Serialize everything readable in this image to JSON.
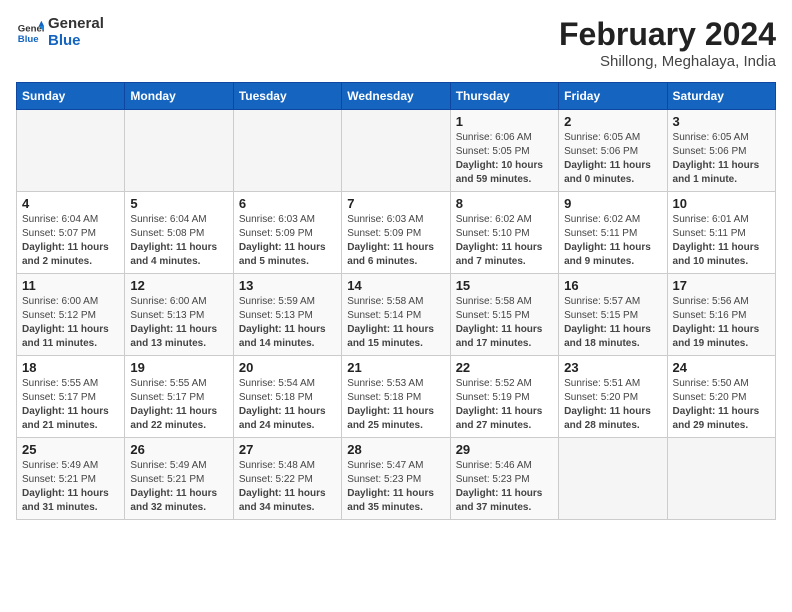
{
  "header": {
    "logo_line1": "General",
    "logo_line2": "Blue",
    "title": "February 2024",
    "subtitle": "Shillong, Meghalaya, India"
  },
  "days_of_week": [
    "Sunday",
    "Monday",
    "Tuesday",
    "Wednesday",
    "Thursday",
    "Friday",
    "Saturday"
  ],
  "weeks": [
    [
      {
        "day": "",
        "sunrise": "",
        "sunset": "",
        "daylight": "",
        "empty": true
      },
      {
        "day": "",
        "sunrise": "",
        "sunset": "",
        "daylight": "",
        "empty": true
      },
      {
        "day": "",
        "sunrise": "",
        "sunset": "",
        "daylight": "",
        "empty": true
      },
      {
        "day": "",
        "sunrise": "",
        "sunset": "",
        "daylight": "",
        "empty": true
      },
      {
        "day": "1",
        "sunrise": "Sunrise: 6:06 AM",
        "sunset": "Sunset: 5:05 PM",
        "daylight": "Daylight: 10 hours and 59 minutes.",
        "empty": false
      },
      {
        "day": "2",
        "sunrise": "Sunrise: 6:05 AM",
        "sunset": "Sunset: 5:06 PM",
        "daylight": "Daylight: 11 hours and 0 minutes.",
        "empty": false
      },
      {
        "day": "3",
        "sunrise": "Sunrise: 6:05 AM",
        "sunset": "Sunset: 5:06 PM",
        "daylight": "Daylight: 11 hours and 1 minute.",
        "empty": false
      }
    ],
    [
      {
        "day": "4",
        "sunrise": "Sunrise: 6:04 AM",
        "sunset": "Sunset: 5:07 PM",
        "daylight": "Daylight: 11 hours and 2 minutes.",
        "empty": false
      },
      {
        "day": "5",
        "sunrise": "Sunrise: 6:04 AM",
        "sunset": "Sunset: 5:08 PM",
        "daylight": "Daylight: 11 hours and 4 minutes.",
        "empty": false
      },
      {
        "day": "6",
        "sunrise": "Sunrise: 6:03 AM",
        "sunset": "Sunset: 5:09 PM",
        "daylight": "Daylight: 11 hours and 5 minutes.",
        "empty": false
      },
      {
        "day": "7",
        "sunrise": "Sunrise: 6:03 AM",
        "sunset": "Sunset: 5:09 PM",
        "daylight": "Daylight: 11 hours and 6 minutes.",
        "empty": false
      },
      {
        "day": "8",
        "sunrise": "Sunrise: 6:02 AM",
        "sunset": "Sunset: 5:10 PM",
        "daylight": "Daylight: 11 hours and 7 minutes.",
        "empty": false
      },
      {
        "day": "9",
        "sunrise": "Sunrise: 6:02 AM",
        "sunset": "Sunset: 5:11 PM",
        "daylight": "Daylight: 11 hours and 9 minutes.",
        "empty": false
      },
      {
        "day": "10",
        "sunrise": "Sunrise: 6:01 AM",
        "sunset": "Sunset: 5:11 PM",
        "daylight": "Daylight: 11 hours and 10 minutes.",
        "empty": false
      }
    ],
    [
      {
        "day": "11",
        "sunrise": "Sunrise: 6:00 AM",
        "sunset": "Sunset: 5:12 PM",
        "daylight": "Daylight: 11 hours and 11 minutes.",
        "empty": false
      },
      {
        "day": "12",
        "sunrise": "Sunrise: 6:00 AM",
        "sunset": "Sunset: 5:13 PM",
        "daylight": "Daylight: 11 hours and 13 minutes.",
        "empty": false
      },
      {
        "day": "13",
        "sunrise": "Sunrise: 5:59 AM",
        "sunset": "Sunset: 5:13 PM",
        "daylight": "Daylight: 11 hours and 14 minutes.",
        "empty": false
      },
      {
        "day": "14",
        "sunrise": "Sunrise: 5:58 AM",
        "sunset": "Sunset: 5:14 PM",
        "daylight": "Daylight: 11 hours and 15 minutes.",
        "empty": false
      },
      {
        "day": "15",
        "sunrise": "Sunrise: 5:58 AM",
        "sunset": "Sunset: 5:15 PM",
        "daylight": "Daylight: 11 hours and 17 minutes.",
        "empty": false
      },
      {
        "day": "16",
        "sunrise": "Sunrise: 5:57 AM",
        "sunset": "Sunset: 5:15 PM",
        "daylight": "Daylight: 11 hours and 18 minutes.",
        "empty": false
      },
      {
        "day": "17",
        "sunrise": "Sunrise: 5:56 AM",
        "sunset": "Sunset: 5:16 PM",
        "daylight": "Daylight: 11 hours and 19 minutes.",
        "empty": false
      }
    ],
    [
      {
        "day": "18",
        "sunrise": "Sunrise: 5:55 AM",
        "sunset": "Sunset: 5:17 PM",
        "daylight": "Daylight: 11 hours and 21 minutes.",
        "empty": false
      },
      {
        "day": "19",
        "sunrise": "Sunrise: 5:55 AM",
        "sunset": "Sunset: 5:17 PM",
        "daylight": "Daylight: 11 hours and 22 minutes.",
        "empty": false
      },
      {
        "day": "20",
        "sunrise": "Sunrise: 5:54 AM",
        "sunset": "Sunset: 5:18 PM",
        "daylight": "Daylight: 11 hours and 24 minutes.",
        "empty": false
      },
      {
        "day": "21",
        "sunrise": "Sunrise: 5:53 AM",
        "sunset": "Sunset: 5:18 PM",
        "daylight": "Daylight: 11 hours and 25 minutes.",
        "empty": false
      },
      {
        "day": "22",
        "sunrise": "Sunrise: 5:52 AM",
        "sunset": "Sunset: 5:19 PM",
        "daylight": "Daylight: 11 hours and 27 minutes.",
        "empty": false
      },
      {
        "day": "23",
        "sunrise": "Sunrise: 5:51 AM",
        "sunset": "Sunset: 5:20 PM",
        "daylight": "Daylight: 11 hours and 28 minutes.",
        "empty": false
      },
      {
        "day": "24",
        "sunrise": "Sunrise: 5:50 AM",
        "sunset": "Sunset: 5:20 PM",
        "daylight": "Daylight: 11 hours and 29 minutes.",
        "empty": false
      }
    ],
    [
      {
        "day": "25",
        "sunrise": "Sunrise: 5:49 AM",
        "sunset": "Sunset: 5:21 PM",
        "daylight": "Daylight: 11 hours and 31 minutes.",
        "empty": false
      },
      {
        "day": "26",
        "sunrise": "Sunrise: 5:49 AM",
        "sunset": "Sunset: 5:21 PM",
        "daylight": "Daylight: 11 hours and 32 minutes.",
        "empty": false
      },
      {
        "day": "27",
        "sunrise": "Sunrise: 5:48 AM",
        "sunset": "Sunset: 5:22 PM",
        "daylight": "Daylight: 11 hours and 34 minutes.",
        "empty": false
      },
      {
        "day": "28",
        "sunrise": "Sunrise: 5:47 AM",
        "sunset": "Sunset: 5:23 PM",
        "daylight": "Daylight: 11 hours and 35 minutes.",
        "empty": false
      },
      {
        "day": "29",
        "sunrise": "Sunrise: 5:46 AM",
        "sunset": "Sunset: 5:23 PM",
        "daylight": "Daylight: 11 hours and 37 minutes.",
        "empty": false
      },
      {
        "day": "",
        "sunrise": "",
        "sunset": "",
        "daylight": "",
        "empty": true
      },
      {
        "day": "",
        "sunrise": "",
        "sunset": "",
        "daylight": "",
        "empty": true
      }
    ]
  ]
}
